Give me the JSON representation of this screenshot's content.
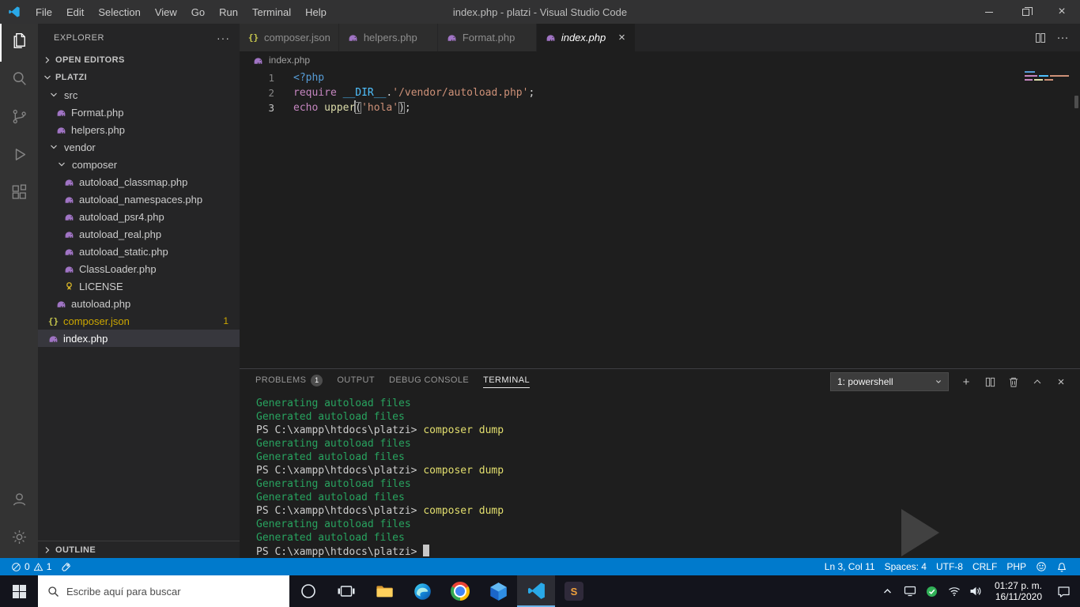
{
  "window": {
    "title": "index.php - platzi - Visual Studio Code"
  },
  "title_bar": {
    "menus": [
      "File",
      "Edit",
      "Selection",
      "View",
      "Go",
      "Run",
      "Terminal",
      "Help"
    ]
  },
  "activity_bar": {
    "items": [
      {
        "name": "explorer",
        "active": true
      },
      {
        "name": "search",
        "active": false
      },
      {
        "name": "source-control",
        "active": false
      },
      {
        "name": "run-debug",
        "active": false
      },
      {
        "name": "extensions",
        "active": false
      }
    ],
    "bottom": [
      {
        "name": "account",
        "active": false
      },
      {
        "name": "settings",
        "active": false
      }
    ]
  },
  "sidebar": {
    "title": "EXPLORER",
    "sections": {
      "open_editors": "OPEN EDITORS",
      "root": "PLATZI",
      "outline": "OUTLINE"
    },
    "tree": [
      {
        "label": "src",
        "type": "folder",
        "depth": 1
      },
      {
        "label": "Format.php",
        "type": "php",
        "depth": 2
      },
      {
        "label": "helpers.php",
        "type": "php",
        "depth": 2
      },
      {
        "label": "vendor",
        "type": "folder",
        "depth": 1
      },
      {
        "label": "composer",
        "type": "folder",
        "depth": 2
      },
      {
        "label": "autoload_classmap.php",
        "type": "php",
        "depth": 3
      },
      {
        "label": "autoload_namespaces.php",
        "type": "php",
        "depth": 3
      },
      {
        "label": "autoload_psr4.php",
        "type": "php",
        "depth": 3
      },
      {
        "label": "autoload_real.php",
        "type": "php",
        "depth": 3
      },
      {
        "label": "autoload_static.php",
        "type": "php",
        "depth": 3
      },
      {
        "label": "ClassLoader.php",
        "type": "php",
        "depth": 3
      },
      {
        "label": "LICENSE",
        "type": "license",
        "depth": 3
      },
      {
        "label": "autoload.php",
        "type": "php",
        "depth": 2
      },
      {
        "label": "composer.json",
        "type": "json",
        "depth": 1,
        "badge": "1",
        "warning": true
      },
      {
        "label": "index.php",
        "type": "php",
        "depth": 1,
        "selected": true
      }
    ]
  },
  "editor": {
    "tabs": [
      {
        "label": "composer.json",
        "icon": "json",
        "active": false
      },
      {
        "label": "helpers.php",
        "icon": "php",
        "active": false
      },
      {
        "label": "Format.php",
        "icon": "php",
        "active": false
      },
      {
        "label": "index.php",
        "icon": "php",
        "active": true
      }
    ],
    "breadcrumb": "index.php",
    "code": [
      {
        "num": "1",
        "active": false,
        "tokens": [
          {
            "text": "<?php",
            "color": "tag"
          }
        ]
      },
      {
        "num": "2",
        "active": false,
        "tokens": [
          {
            "text": "require ",
            "color": "keyword"
          },
          {
            "text": "__DIR__",
            "color": "constant"
          },
          {
            "text": ".",
            "color": "plain"
          },
          {
            "text": "'/vendor/autoload.php'",
            "color": "string"
          },
          {
            "text": ";",
            "color": "plain"
          }
        ]
      },
      {
        "num": "3",
        "active": true,
        "tokens": [
          {
            "text": "echo ",
            "color": "keyword"
          },
          {
            "text": "upper",
            "color": "function"
          },
          {
            "text": "(",
            "color": "plain",
            "bracket": true,
            "cursor": true
          },
          {
            "text": "'hola'",
            "color": "string"
          },
          {
            "text": ")",
            "color": "plain",
            "bracket": true
          },
          {
            "text": ";",
            "color": "plain"
          }
        ]
      }
    ]
  },
  "panel": {
    "tabs": [
      {
        "label": "PROBLEMS",
        "badge": "1",
        "active": false
      },
      {
        "label": "OUTPUT",
        "active": false
      },
      {
        "label": "DEBUG CONSOLE",
        "active": false
      },
      {
        "label": "TERMINAL",
        "active": true
      }
    ],
    "shell_selector": "1: powershell",
    "terminal": {
      "prompt": "PS C:\\xampp\\htdocs\\platzi>",
      "lines": [
        {
          "kind": "out",
          "text": "Generating autoload files"
        },
        {
          "kind": "out",
          "text": "Generated autoload files"
        },
        {
          "kind": "cmd",
          "text": "composer dump"
        },
        {
          "kind": "out",
          "text": "Generating autoload files"
        },
        {
          "kind": "out",
          "text": "Generated autoload files"
        },
        {
          "kind": "cmd",
          "text": "composer dump"
        },
        {
          "kind": "out",
          "text": "Generating autoload files"
        },
        {
          "kind": "out",
          "text": "Generated autoload files"
        },
        {
          "kind": "cmd",
          "text": "composer dump"
        },
        {
          "kind": "out",
          "text": "Generating autoload files"
        },
        {
          "kind": "out",
          "text": "Generated autoload files"
        },
        {
          "kind": "cursor",
          "text": ""
        }
      ]
    }
  },
  "status_bar": {
    "errors": "0",
    "warnings": "1",
    "line_col": "Ln 3, Col 11",
    "spaces": "Spaces: 4",
    "encoding": "UTF-8",
    "eol": "CRLF",
    "language": "PHP"
  },
  "taskbar": {
    "search_placeholder": "Escribe aquí para buscar",
    "time": "01:27 p. m.",
    "date": "16/11/2020",
    "apps": [
      {
        "name": "file-explorer",
        "active": false
      },
      {
        "name": "edge",
        "active": false
      },
      {
        "name": "chrome",
        "active": false
      },
      {
        "name": "blue-cube-app",
        "active": false
      },
      {
        "name": "vscode",
        "active": true
      },
      {
        "name": "s-app",
        "active": false,
        "glyph": "S"
      }
    ]
  },
  "colors": {
    "accent": "#007acc",
    "warning": "#cca700",
    "terminal_green": "#28a35f",
    "terminal_yellow": "#e3df6e"
  }
}
